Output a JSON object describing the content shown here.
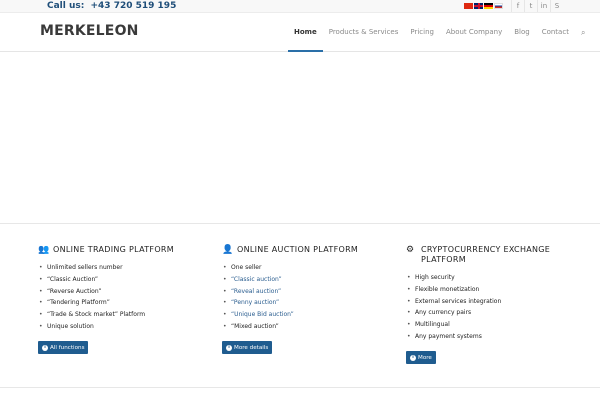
{
  "topbar": {
    "call_label": "Call us:",
    "phone": "+43 720 519 195",
    "flags": [
      "cn-flag",
      "gb-flag",
      "de-flag",
      "ru-flag"
    ],
    "socials": [
      {
        "name": "facebook-icon",
        "glyph": "f"
      },
      {
        "name": "twitter-icon",
        "glyph": "t"
      },
      {
        "name": "linkedin-icon",
        "glyph": "in"
      },
      {
        "name": "skype-icon",
        "glyph": "S"
      }
    ]
  },
  "header": {
    "logo": "MERKELEON",
    "nav": [
      "Home",
      "Products & Services",
      "Pricing",
      "About Company",
      "Blog",
      "Contact"
    ],
    "search_glyph": "⌕"
  },
  "columns": [
    {
      "icon": "users-icon",
      "icon_glyph": "👥",
      "title": "ONLINE TRADING PLATFORM",
      "items": [
        "Unlimited sellers number",
        "“Classic Auction”",
        "“Reverse Auction”",
        "“Tendering Platform”",
        "“Trade & Stock market” Platform",
        "Unique solution"
      ],
      "button": "All functions"
    },
    {
      "icon": "user-icon",
      "icon_glyph": "👤",
      "title": "ONLINE AUCTION PLATFORM",
      "items": [
        "One seller",
        "“Classic auction”",
        "“Reveal auction”",
        "“Penny auction”",
        "“Unique Bid auction”",
        "“Mixed auction”"
      ],
      "button": "More details"
    },
    {
      "icon": "globe-icon",
      "icon_glyph": "⚙",
      "title": "CRYPTOCURRENCY EXCHANGE PLATFORM",
      "items": [
        "High security",
        "Flexible monetization",
        "External services integration",
        "Any currency pairs",
        "Multilingual",
        "Any payment systems"
      ],
      "button": "More"
    }
  ],
  "colors": {
    "accent": "#1f5c8f",
    "link": "#2a5d8f"
  }
}
